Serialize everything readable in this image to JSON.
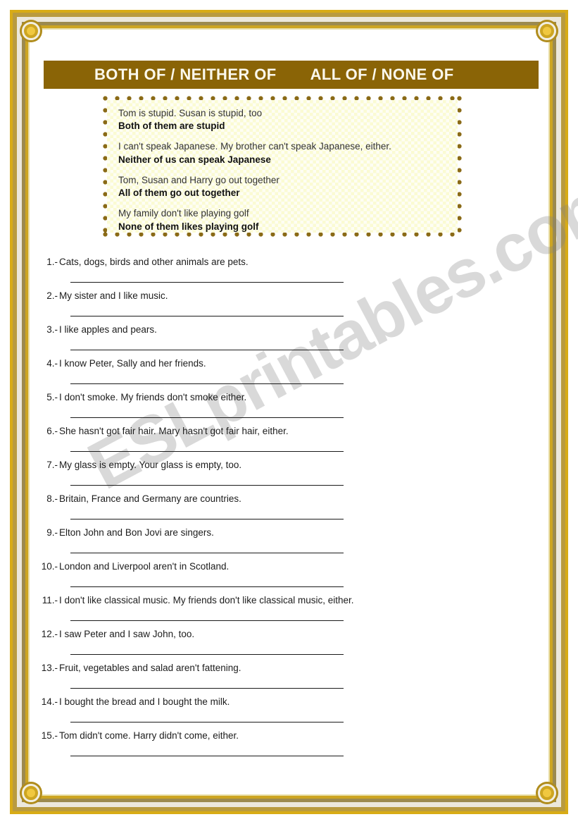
{
  "header": {
    "title_main": "BOTH OF / NEITHER OF",
    "title_sub": "ALL OF / NONE OF"
  },
  "examples": [
    {
      "prompt": "Tom is stupid. Susan is stupid, too",
      "answer": "Both of them are stupid"
    },
    {
      "prompt": "I can't speak Japanese. My brother can't speak Japanese, either.",
      "answer": "Neither of us can speak Japanese"
    },
    {
      "prompt": "Tom, Susan and Harry go out together",
      "answer": "All of them go out together"
    },
    {
      "prompt": "My family don't like playing golf",
      "answer": "None of them likes playing golf"
    }
  ],
  "exercises": [
    {
      "number": "1.-",
      "text": "Cats, dogs, birds and other animals are pets."
    },
    {
      "number": "2.-",
      "text": "My sister and I like music."
    },
    {
      "number": "3.-",
      "text": "I like apples and pears."
    },
    {
      "number": "4.-",
      "text": "I know Peter, Sally and her friends."
    },
    {
      "number": "5.-",
      "text": "I don't smoke. My friends don't smoke either."
    },
    {
      "number": "6.-",
      "text": "She hasn't got fair hair. Mary hasn't got fair hair, either."
    },
    {
      "number": "7.-",
      "text": "My glass is empty. Your glass is empty, too."
    },
    {
      "number": "8.-",
      "text": "Britain, France and Germany are countries."
    },
    {
      "number": "9.-",
      "text": "Elton John and Bon Jovi are singers."
    },
    {
      "number": "10.-",
      "text": "London and Liverpool aren't in Scotland."
    },
    {
      "number": "11.-",
      "text": "I don't like classical music. My friends don't like classical music, either."
    },
    {
      "number": "12.-",
      "text": "I saw Peter and I saw John, too."
    },
    {
      "number": "13.-",
      "text": "Fruit, vegetables and salad aren't fattening."
    },
    {
      "number": "14.-",
      "text": "I bought the bread and I bought the milk."
    },
    {
      "number": "15.-",
      "text": "Tom didn't come. Harry didn't come, either."
    }
  ],
  "watermark": {
    "text": "ESLprintables.com"
  },
  "colors": {
    "header_bar": "#8a6406",
    "header_text": "#fbf8ec",
    "example_box_bg": "#fbfbd3",
    "example_dot": "#8a6a16",
    "frame_gold": "#cda521",
    "frame_olive": "#9c8a4e",
    "frame_cream": "#ece8dc",
    "rule_line": "#1a1a1a"
  }
}
